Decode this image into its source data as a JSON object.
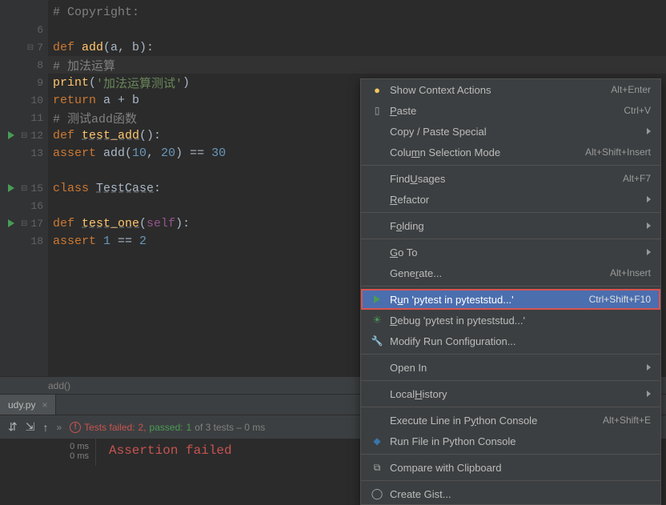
{
  "gutter": {
    "lines": [
      "",
      "6",
      "7",
      "8",
      "9",
      "10",
      "11",
      "12",
      "13",
      "",
      "15",
      "16",
      "17",
      "18",
      ""
    ],
    "runIcons": [
      12,
      15,
      17
    ]
  },
  "code": {
    "l5": "# Copyright:",
    "l7": {
      "def": "def ",
      "fn": "add",
      "args": "(a, b):"
    },
    "l8_comment": "# 加法运算",
    "l9": {
      "print": "print",
      "str": "'加法运算测试'"
    },
    "l10": {
      "return": "return ",
      "expr": "a + b"
    },
    "l11_comment": "# 测试add函数",
    "l12": {
      "def": "def ",
      "fn": "test_add",
      "args": "():"
    },
    "l13": {
      "assert": "assert ",
      "call": "add(",
      "n1": "10",
      "c": ", ",
      "n2": "20",
      "end": ") == ",
      "n3": "30"
    },
    "l15": {
      "class": "class ",
      "name": "TestCase",
      "colon": ":"
    },
    "l17": {
      "def": "def ",
      "fn": "test_one",
      "args": "(",
      "self": "self",
      "args2": "):"
    },
    "l18": {
      "assert": "assert ",
      "n1": "1",
      "eq": " == ",
      "n2": "2"
    }
  },
  "breadcrumb": "add()",
  "tab": {
    "label": "udy.py",
    "close": "×"
  },
  "toolbar": {
    "chevrons": "»",
    "failedLabel": "Tests failed: ",
    "failedCount": "2,",
    "passedLabel": " passed: ",
    "passedCount": "1",
    "ofLabel": " of 3 tests – 0 ms"
  },
  "timeCol": {
    "t1": "0 ms",
    "t2": "0 ms"
  },
  "resultText": "Assertion failed",
  "menu": {
    "items": [
      {
        "id": "show-context-actions",
        "label": "Show Context Actions",
        "shortcut": "Alt+Enter",
        "icon": "lamp"
      },
      {
        "id": "paste",
        "labelHtml": "<span class='underline-char'>P</span>aste",
        "shortcut": "Ctrl+V",
        "icon": "clip"
      },
      {
        "id": "copy-paste-special",
        "label": "Copy / Paste Special",
        "submenu": true
      },
      {
        "id": "column-selection",
        "labelHtml": "Colu<span class='underline-char'>m</span>n Selection Mode",
        "shortcut": "Alt+Shift+Insert"
      },
      {
        "sep": true
      },
      {
        "id": "find-usages",
        "labelHtml": "Find <span class='underline-char'>U</span>sages",
        "shortcut": "Alt+F7"
      },
      {
        "id": "refactor",
        "labelHtml": "<span class='underline-char'>R</span>efactor",
        "submenu": true
      },
      {
        "sep": true
      },
      {
        "id": "folding",
        "labelHtml": "F<span class='underline-char'>o</span>lding",
        "submenu": true
      },
      {
        "sep": true
      },
      {
        "id": "goto",
        "labelHtml": "<span class='underline-char'>G</span>o To",
        "submenu": true
      },
      {
        "id": "generate",
        "labelHtml": "Gene<span class='underline-char'>r</span>ate...",
        "shortcut": "Alt+Insert"
      },
      {
        "sep": true
      },
      {
        "id": "run-pytest",
        "labelHtml": "R<span class='underline-char'>u</span>n 'pytest in pyteststud...'",
        "shortcut": "Ctrl+Shift+F10",
        "icon": "play",
        "selected": true,
        "highlighted": true
      },
      {
        "id": "debug-pytest",
        "labelHtml": "<span class='underline-char'>D</span>ebug 'pytest in pyteststud...'",
        "icon": "bug"
      },
      {
        "id": "modify-run-config",
        "label": "Modify Run Configuration...",
        "icon": "wrench"
      },
      {
        "sep": true
      },
      {
        "id": "open-in",
        "label": "Open In",
        "submenu": true
      },
      {
        "sep": true
      },
      {
        "id": "local-history",
        "labelHtml": "Local <span class='underline-char'>H</span>istory",
        "submenu": true
      },
      {
        "sep": true
      },
      {
        "id": "execute-console",
        "labelHtml": "Execute Line in P<span class='underline-char'>y</span>thon Console",
        "shortcut": "Alt+Shift+E"
      },
      {
        "id": "run-file-console",
        "label": "Run File in Python Console",
        "icon": "py"
      },
      {
        "sep": true
      },
      {
        "id": "compare-clipboard",
        "label": "Compare with Clipboard",
        "icon": "diff"
      },
      {
        "sep": true
      },
      {
        "id": "create-gist",
        "label": "Create Gist...",
        "icon": "gh"
      }
    ]
  }
}
